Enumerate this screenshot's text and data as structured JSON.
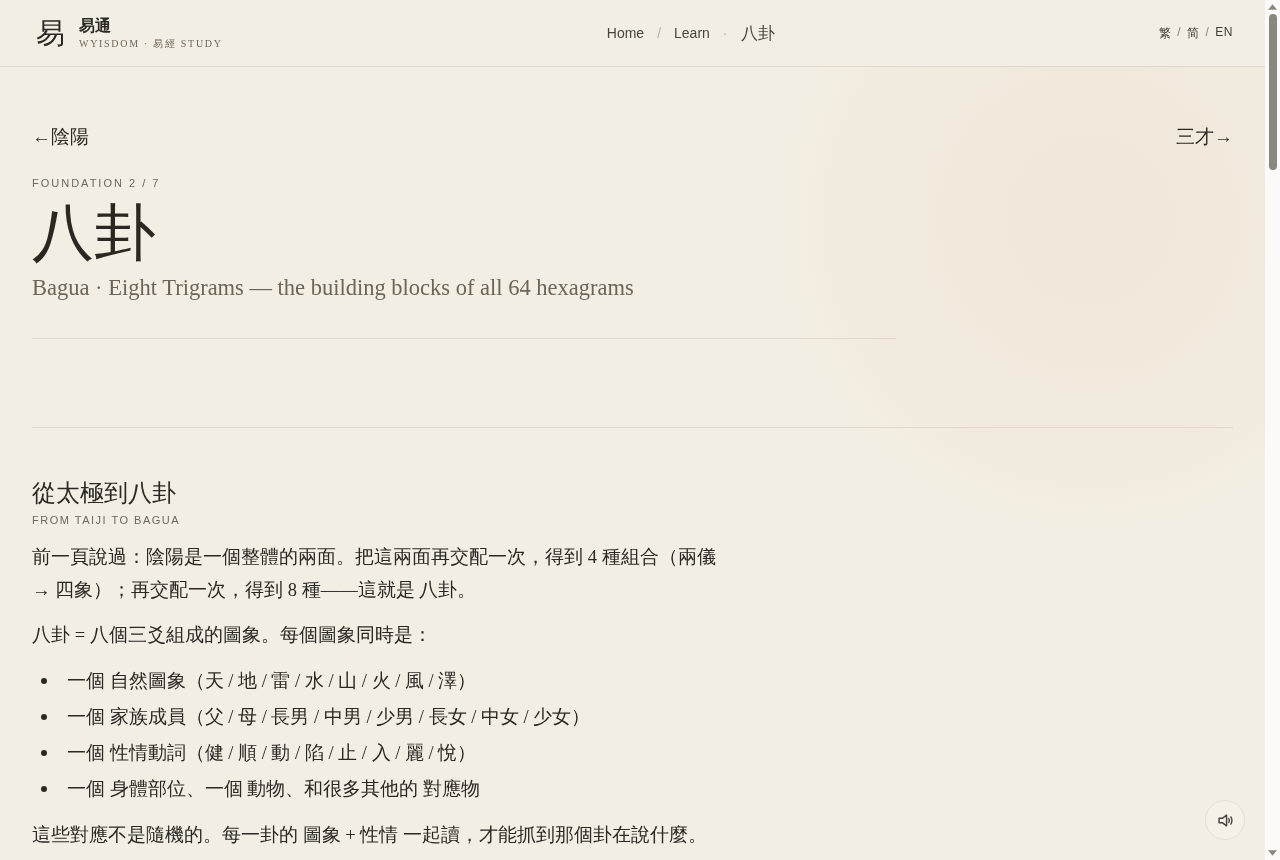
{
  "header": {
    "logo_glyph": "易",
    "brand_name": "易通",
    "brand_tagline": "WYISDOM · 易經 STUDY",
    "breadcrumb": [
      {
        "kind": "link",
        "label": "Home"
      },
      {
        "kind": "separator",
        "label": "/"
      },
      {
        "kind": "link",
        "label": "Learn"
      },
      {
        "kind": "separator",
        "label": "·"
      },
      {
        "kind": "current",
        "label": "八卦"
      }
    ],
    "language_switch": [
      {
        "kind": "option",
        "label": "繁"
      },
      {
        "kind": "separator",
        "label": "/"
      },
      {
        "kind": "option",
        "label": "简"
      },
      {
        "kind": "separator",
        "label": "/"
      },
      {
        "kind": "option",
        "label": "EN"
      }
    ]
  },
  "pager": {
    "previous": {
      "arrow": "←",
      "label": "陰陽"
    },
    "next": {
      "label": "三才",
      "arrow": "→"
    }
  },
  "hero": {
    "eyebrow": "FOUNDATION 2 / 7",
    "title": "八卦",
    "subtitle": "Bagua · Eight Trigrams — the building blocks of all 64 hexagrams"
  },
  "section": {
    "heading": "從太極到八卦",
    "subheading": "FROM TAIJI TO BAGUA",
    "blocks": [
      {
        "kind": "paragraph",
        "text": "前一頁說過：陰陽是一個整體的兩面。把這兩面再交配一次，得到 4 種組合（兩儀 → 四象）；再交配一次，得到 8 種——這就是 八卦。"
      },
      {
        "kind": "paragraph",
        "text": "八卦 = 八個三爻組成的圖象。每個圖象同時是："
      },
      {
        "kind": "list",
        "items": [
          "一個 自然圖象（天 / 地 / 雷 / 水 / 山 / 火 / 風 / 澤）",
          "一個 家族成員（父 / 母 / 長男 / 中男 / 少男 / 長女 / 中女 / 少女）",
          "一個 性情動詞（健 / 順 / 動 / 陷 / 止 / 入 / 麗 / 悅）",
          "一個 身體部位、一個 動物、和很多其他的 對應物"
        ]
      },
      {
        "kind": "paragraph",
        "text": "這些對應不是隨機的。每一卦的 圖象 + 性情 一起讀，才能抓到那個卦在說什麼。"
      }
    ]
  }
}
